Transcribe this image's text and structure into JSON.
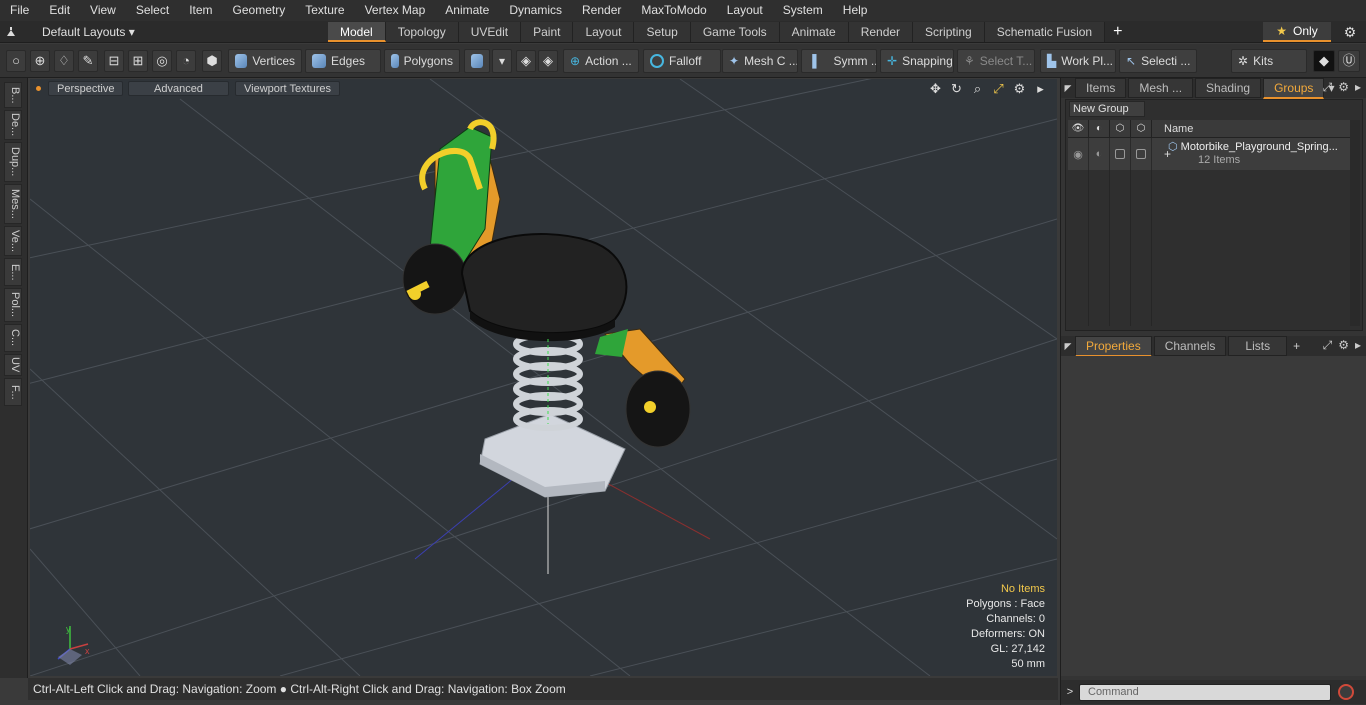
{
  "menu": [
    "File",
    "Edit",
    "View",
    "Select",
    "Item",
    "Geometry",
    "Texture",
    "Vertex Map",
    "Animate",
    "Dynamics",
    "Render",
    "MaxToModo",
    "Layout",
    "System",
    "Help"
  ],
  "layoutbar": {
    "layout_label": "Default Layouts ▾",
    "tabs": [
      "Model",
      "Topology",
      "UVEdit",
      "Paint",
      "Layout",
      "Setup",
      "Game Tools",
      "Animate",
      "Render",
      "Scripting",
      "Schematic Fusion"
    ],
    "active_tab": "Model",
    "plus": "+",
    "only_label": "Only",
    "star": "★",
    "gear": "⚙"
  },
  "toolbar": {
    "vertices": "Vertices",
    "edges": "Edges",
    "polygons": "Polygons",
    "action": "Action ...",
    "falloff": "Falloff",
    "mesh": "Mesh C ...",
    "symm": "Symm ...",
    "snapping": "Snapping",
    "select_t": "Select T...",
    "workpl": "Work Pl...",
    "selecti": "Selecti ...",
    "kits": "Kits"
  },
  "left_tabs": [
    "B...",
    "De...",
    "Dup...",
    "Mes...",
    "Ve...",
    "E...",
    "Pol...",
    "C...",
    "UV",
    "F..."
  ],
  "viewport": {
    "perspective": "Perspective",
    "advanced": "Advanced",
    "textures": "Viewport Textures",
    "axis_x": "x",
    "axis_y": "y"
  },
  "stats": {
    "items": "No Items",
    "polygons": "Polygons : Face",
    "channels": "Channels: 0",
    "deformers": "Deformers: ON",
    "gl": "GL: 27,142",
    "size": "50 mm"
  },
  "status": "Ctrl-Alt-Left Click and Drag: Navigation: Zoom ● Ctrl-Alt-Right Click and Drag: Navigation: Box Zoom",
  "right_tabs": {
    "items": "Items",
    "mesh": "Mesh ...",
    "shading": "Shading",
    "groups": "Groups"
  },
  "groups": {
    "new_group": "New Group",
    "col_name": "Name",
    "row_label": "Motorbike_Playground_Spring...",
    "row_sub": "12 Items",
    "expand": "+"
  },
  "props_tabs": {
    "properties": "Properties",
    "channels": "Channels",
    "lists": "Lists",
    "plus": "+"
  },
  "command": {
    "placeholder": "Command",
    "arrow": ">"
  },
  "colors": {
    "accent": "#e8912d",
    "viewport_bg": "#2f3439",
    "green": "#2fa53a",
    "orange": "#e49a2a",
    "yellow": "#f2cf2a",
    "black": "#151515"
  }
}
